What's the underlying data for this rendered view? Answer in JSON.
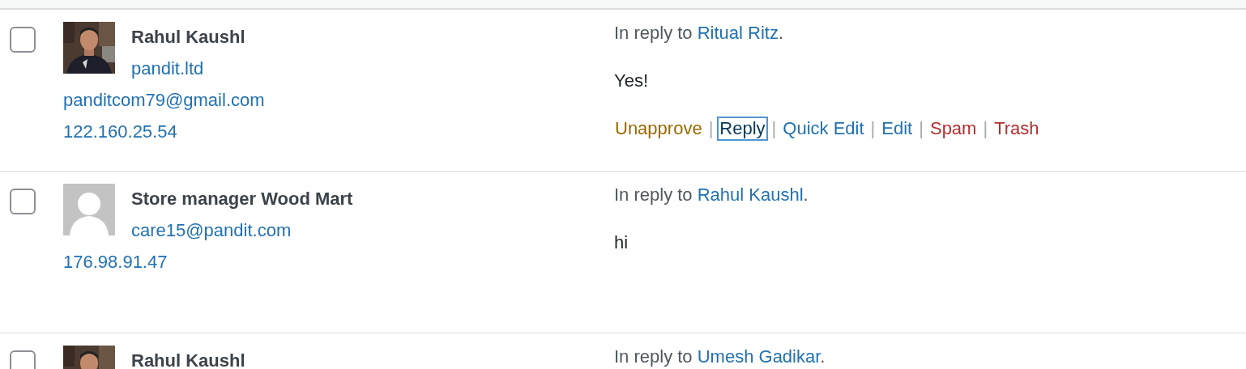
{
  "action_separator": "|",
  "comments": [
    {
      "checked": false,
      "author": "Rahul Kaushl",
      "lines": [
        "pandit.ltd",
        "panditcom79@gmail.com",
        "122.160.25.54"
      ],
      "reply": {
        "prefix": "In reply to ",
        "link": "Ritual Ritz",
        "suffix": "."
      },
      "text": "Yes!",
      "actions": [
        {
          "label": "Unapprove",
          "kind": "approve",
          "focused": false
        },
        {
          "label": "Reply",
          "kind": "link",
          "focused": true
        },
        {
          "label": "Quick Edit",
          "kind": "link",
          "focused": false
        },
        {
          "label": "Edit",
          "kind": "link",
          "focused": false
        },
        {
          "label": "Spam",
          "kind": "danger",
          "focused": false
        },
        {
          "label": "Trash",
          "kind": "danger",
          "focused": false
        }
      ]
    },
    {
      "checked": false,
      "avatar": {
        "kind": "default"
      },
      "author": "Store manager Wood Mart",
      "lines": [
        "care15@pandit.com",
        "176.98.91.47"
      ],
      "reply": {
        "prefix": "In reply to ",
        "link": "Rahul Kaushl",
        "suffix": "."
      },
      "text": "hi"
    },
    {
      "checked": false,
      "author": "Rahul Kaushl",
      "reply": {
        "prefix": "In reply to ",
        "link": "Umesh Gadikar",
        "suffix": "."
      }
    }
  ]
}
